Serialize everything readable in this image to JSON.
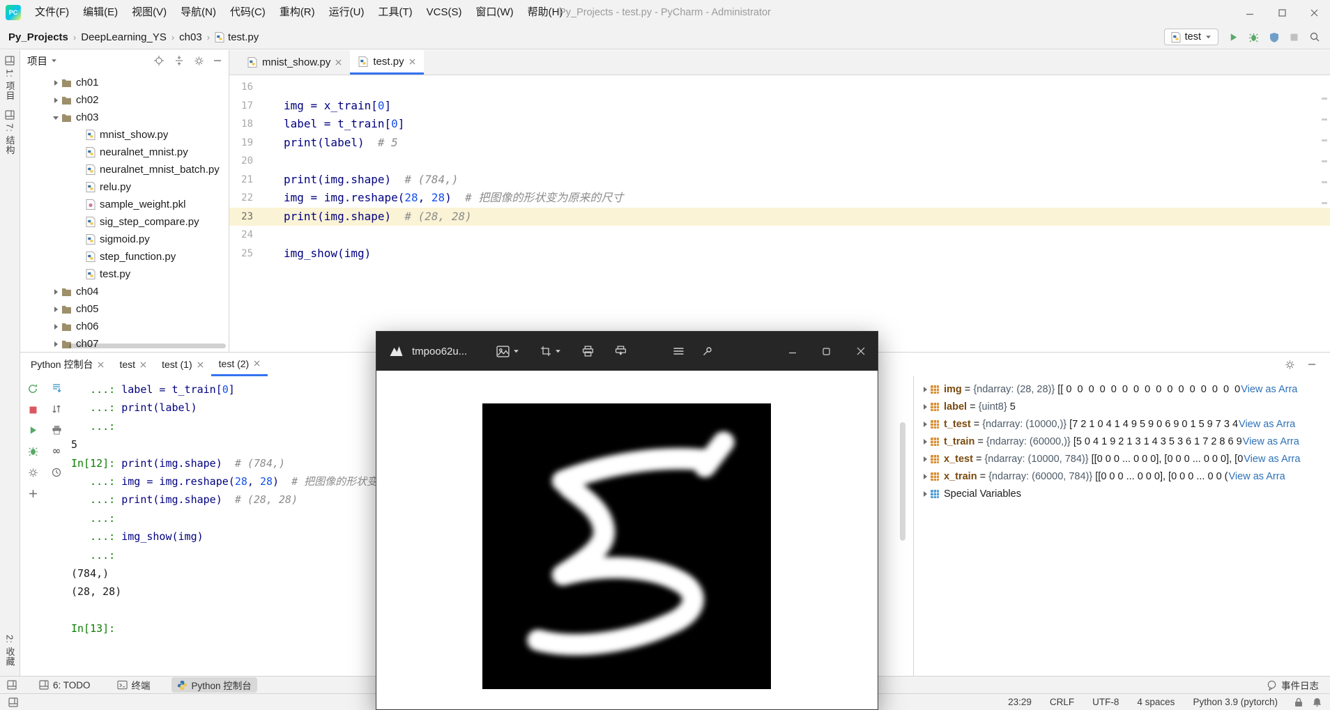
{
  "colors": {
    "accent": "#3574f0",
    "run_green": "#59a869",
    "stop_red": "#db5860",
    "console_prompt_green": "#0a7d00",
    "code_text": "#000080",
    "code_number": "#1750eb",
    "code_comment": "#8c8c8c",
    "link_blue": "#2e71b8",
    "caret_line": "#fbf3d5",
    "panel_bg": "#f2f2f2",
    "float_titlebar": "#262626"
  },
  "titlebar": {
    "title": "Py_Projects - test.py - PyCharm - Administrator",
    "menu": [
      "文件(F)",
      "编辑(E)",
      "视图(V)",
      "导航(N)",
      "代码(C)",
      "重构(R)",
      "运行(U)",
      "工具(T)",
      "VCS(S)",
      "窗口(W)",
      "帮助(H)"
    ],
    "controls": [
      {
        "icon": "minD",
        "name": "minimize-button"
      },
      {
        "icon": "maxD",
        "name": "maximize-button"
      },
      {
        "icon": "closeD",
        "name": "close-button"
      }
    ]
  },
  "navbar": {
    "breadcrumbs": [
      "Py_Projects",
      "DeepLearning_YS",
      "ch03",
      "test.py"
    ],
    "run_config": "test",
    "actions": [
      {
        "icon": "play",
        "name": "run-button"
      },
      {
        "icon": "bug",
        "name": "debug-button"
      },
      {
        "icon": "shield",
        "name": "coverage-button"
      },
      {
        "icon": "stop",
        "name": "stop-button"
      },
      {
        "icon": "search",
        "name": "search-everywhere-button"
      }
    ]
  },
  "left_stripe": {
    "items_top": [
      {
        "icon": "squares",
        "label": "1: 项目",
        "name": "stripe-project"
      },
      {
        "icon": "squares",
        "label": "7: 结构",
        "name": "stripe-structure"
      }
    ],
    "items_bottom": [
      {
        "label": "2: 收藏",
        "name": "stripe-favorites"
      }
    ]
  },
  "project": {
    "header": "项目",
    "header_icons": [
      {
        "icon": "target",
        "name": "locate-file-button"
      },
      {
        "icon": "collapse",
        "name": "collapse-all-button"
      },
      {
        "icon": "gear",
        "name": "project-settings-button"
      },
      {
        "icon": "minus",
        "name": "hide-panel-button"
      }
    ],
    "tree": [
      {
        "name": "ch01",
        "depth": 0,
        "kind": "folder",
        "arrow": "right"
      },
      {
        "name": "ch02",
        "depth": 0,
        "kind": "folder",
        "arrow": "right"
      },
      {
        "name": "ch03",
        "depth": 0,
        "kind": "folder",
        "arrow": "down"
      },
      {
        "name": "mnist_show.py",
        "depth": 1,
        "kind": "py"
      },
      {
        "name": "neuralnet_mnist.py",
        "depth": 1,
        "kind": "py"
      },
      {
        "name": "neuralnet_mnist_batch.py",
        "depth": 1,
        "kind": "py"
      },
      {
        "name": "relu.py",
        "depth": 1,
        "kind": "py"
      },
      {
        "name": "sample_weight.pkl",
        "depth": 1,
        "kind": "pkl"
      },
      {
        "name": "sig_step_compare.py",
        "depth": 1,
        "kind": "py"
      },
      {
        "name": "sigmoid.py",
        "depth": 1,
        "kind": "py"
      },
      {
        "name": "step_function.py",
        "depth": 1,
        "kind": "py"
      },
      {
        "name": "test.py",
        "depth": 1,
        "kind": "py"
      },
      {
        "name": "ch04",
        "depth": 0,
        "kind": "folder",
        "arrow": "right"
      },
      {
        "name": "ch05",
        "depth": 0,
        "kind": "folder",
        "arrow": "right"
      },
      {
        "name": "ch06",
        "depth": 0,
        "kind": "folder",
        "arrow": "right"
      },
      {
        "name": "ch07",
        "depth": 0,
        "kind": "folder",
        "arrow": "right"
      }
    ]
  },
  "editor": {
    "tabs": [
      {
        "label": "mnist_show.py",
        "active": false
      },
      {
        "label": "test.py",
        "active": true
      }
    ],
    "lines": [
      {
        "num": 16,
        "segs": []
      },
      {
        "num": 17,
        "segs": [
          [
            "t",
            "img = x_train["
          ],
          [
            "n",
            "0"
          ],
          [
            "t",
            "]"
          ]
        ]
      },
      {
        "num": 18,
        "segs": [
          [
            "t",
            "label = t_train["
          ],
          [
            "n",
            "0"
          ],
          [
            "t",
            "]"
          ]
        ]
      },
      {
        "num": 19,
        "segs": [
          [
            "t",
            "print(label)  "
          ],
          [
            "c",
            "# 5"
          ]
        ]
      },
      {
        "num": 20,
        "segs": []
      },
      {
        "num": 21,
        "segs": [
          [
            "t",
            "print(img.shape)  "
          ],
          [
            "c",
            "# (784,)"
          ]
        ]
      },
      {
        "num": 22,
        "segs": [
          [
            "t",
            "img = img.reshape("
          ],
          [
            "n",
            "28"
          ],
          [
            "t",
            ", "
          ],
          [
            "n",
            "28"
          ],
          [
            "t",
            ")  "
          ],
          [
            "c",
            "# 把图像的形状变为原来的尺寸"
          ]
        ]
      },
      {
        "num": 23,
        "segs": [
          [
            "t",
            "print(img.shape)  "
          ],
          [
            "c",
            "# (28, 28)"
          ]
        ],
        "highlight": true
      },
      {
        "num": 24,
        "segs": []
      },
      {
        "num": 25,
        "segs": [
          [
            "t",
            "img_show(img)"
          ]
        ]
      }
    ]
  },
  "console": {
    "tabs": [
      {
        "label": "Python 控制台",
        "active": false
      },
      {
        "label": "test",
        "active": false
      },
      {
        "label": "test (1)",
        "active": false
      },
      {
        "label": "test (2)",
        "active": true
      }
    ],
    "tab_icons": [
      {
        "icon": "gear",
        "name": "console-options-button"
      },
      {
        "icon": "minus",
        "name": "hide-console-button"
      }
    ],
    "toolbar_left": [
      {
        "icon": "rerun",
        "name": "rerun-console-button"
      },
      {
        "icon": "stopRed",
        "name": "stop-console-button"
      },
      {
        "icon": "play",
        "name": "resume-button"
      },
      {
        "icon": "bug",
        "name": "attach-debugger-button"
      },
      {
        "icon": "gear",
        "name": "console-settings-button"
      },
      {
        "icon": "plus",
        "name": "new-console-button"
      }
    ],
    "toolbar_right": [
      {
        "icon": "scrollend",
        "name": "scroll-to-end-button"
      },
      {
        "icon": "sort",
        "name": "sort-lines-button"
      },
      {
        "icon": "printer",
        "name": "print-console-button"
      },
      {
        "icon": "infinity",
        "name": "soft-wrap-button"
      },
      {
        "icon": "clock",
        "name": "history-button"
      }
    ],
    "lines": [
      {
        "segs": [
          [
            "p",
            "   ...: "
          ],
          [
            "t",
            "label = t_train["
          ],
          [
            "n",
            "0"
          ],
          [
            "t",
            "]"
          ]
        ]
      },
      {
        "segs": [
          [
            "p",
            "   ...: "
          ],
          [
            "t",
            "print(label)"
          ]
        ]
      },
      {
        "segs": [
          [
            "p",
            "   ...: "
          ]
        ]
      },
      {
        "segs": [
          [
            "o",
            "5"
          ]
        ]
      },
      {
        "segs": [
          [
            "p",
            "In[12]: "
          ],
          [
            "t",
            "print(img.shape)  "
          ],
          [
            "c",
            "# (784,)"
          ]
        ]
      },
      {
        "segs": [
          [
            "p",
            "   ...: "
          ],
          [
            "t",
            "img = img.reshape("
          ],
          [
            "n",
            "28"
          ],
          [
            "t",
            ", "
          ],
          [
            "n",
            "28"
          ],
          [
            "t",
            ")  "
          ],
          [
            "c",
            "# 把图像的形状变为原来的尺寸"
          ]
        ]
      },
      {
        "segs": [
          [
            "p",
            "   ...: "
          ],
          [
            "t",
            "print(img.shape)  "
          ],
          [
            "c",
            "# (28, 28)"
          ]
        ]
      },
      {
        "segs": [
          [
            "p",
            "   ...: "
          ]
        ]
      },
      {
        "segs": [
          [
            "p",
            "   ...: "
          ],
          [
            "t",
            "img_show(img)"
          ]
        ]
      },
      {
        "segs": [
          [
            "p",
            "   ...: "
          ]
        ]
      },
      {
        "segs": [
          [
            "o",
            "(784,)"
          ]
        ]
      },
      {
        "segs": [
          [
            "o",
            "(28, 28)"
          ]
        ]
      },
      {
        "segs": []
      },
      {
        "segs": [
          [
            "p",
            "In[13]: "
          ]
        ]
      }
    ]
  },
  "variables": {
    "rows": [
      {
        "name": "img",
        "type": "{ndarray: (28, 28)}",
        "value": "[[ 0  0  0  0  0  0  0  0  0  0  0  0  0  0  0  0",
        "link": "View as Arra"
      },
      {
        "name": "label",
        "type": "{uint8}",
        "value": "5",
        "link": ""
      },
      {
        "name": "t_test",
        "type": "{ndarray: (10000,)}",
        "value": "[7 2 1 0 4 1 4 9 5 9 0 6 9 0 1 5 9 7 3 4",
        "link": "View as Arra"
      },
      {
        "name": "t_train",
        "type": "{ndarray: (60000,)}",
        "value": "[5 0 4 1 9 2 1 3 1 4 3 5 3 6 1 7 2 8 6 9",
        "link": "View as Arra"
      },
      {
        "name": "x_test",
        "type": "{ndarray: (10000, 784)}",
        "value": "[[0 0 0 ... 0 0 0], [0 0 0 ... 0 0 0], [0",
        "link": "View as Arra"
      },
      {
        "name": "x_train",
        "type": "{ndarray: (60000, 784)}",
        "value": "[[0 0 0 ... 0 0 0], [0 0 0 ... 0 0 (",
        "link": "View as Arra"
      }
    ],
    "special": "Special Variables"
  },
  "float_window": {
    "title": "tmpoo62u...",
    "toolbar": [
      {
        "icon": "image",
        "name": "image-tools-button",
        "dd": true
      },
      {
        "icon": "crop",
        "name": "crop-rotate-button",
        "dd": true
      },
      {
        "icon": "printerL",
        "name": "print-image-button"
      },
      {
        "icon": "printerE",
        "name": "print-export-button"
      }
    ],
    "menu_icons": [
      {
        "icon": "menu",
        "name": "more-menu-button"
      },
      {
        "icon": "pin",
        "name": "pin-button"
      }
    ],
    "controls": [
      {
        "icon": "minL",
        "name": "minimize-button"
      },
      {
        "icon": "maxL",
        "name": "maximize-button"
      },
      {
        "icon": "closeL",
        "name": "close-button"
      }
    ]
  },
  "bottom_bar": {
    "left": [
      {
        "icon": "squares",
        "label": "6: TODO",
        "name": "todo-toolwindow-button",
        "active": false
      },
      {
        "icon": "terminal",
        "label": "终端",
        "name": "terminal-toolwindow-button",
        "active": false
      },
      {
        "icon": "python",
        "label": "Python 控制台",
        "name": "python-console-toolwindow-button",
        "active": true
      }
    ],
    "right": "事件日志"
  },
  "status_bar": {
    "items": [
      "23:29",
      "CRLF",
      "UTF-8",
      "4 spaces",
      "Python 3.9 (pytorch)"
    ],
    "icons": [
      {
        "icon": "lock",
        "name": "lock-icon"
      },
      {
        "icon": "bell",
        "name": "notifications-icon"
      }
    ]
  }
}
